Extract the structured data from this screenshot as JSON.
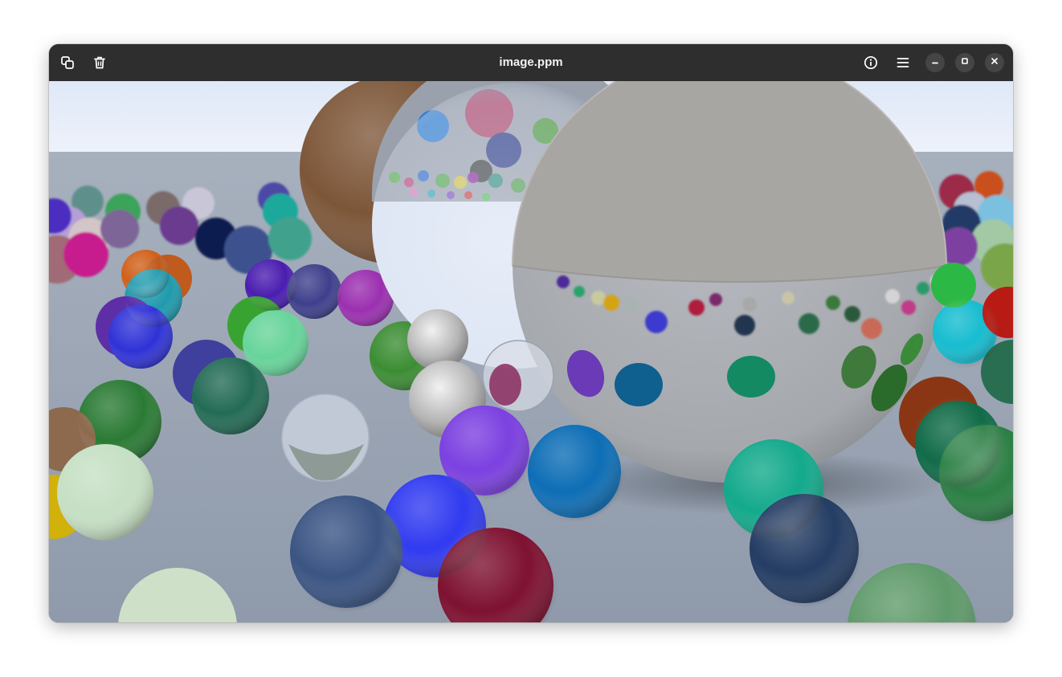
{
  "window": {
    "title": "image.ppm"
  },
  "toolbar": {
    "left": [
      {
        "name": "copy-button",
        "icon": "copy-icon"
      },
      {
        "name": "delete-button",
        "icon": "trash-icon"
      }
    ],
    "right": [
      {
        "name": "properties-button",
        "icon": "info-icon"
      },
      {
        "name": "main-menu-button",
        "icon": "hamburger-menu-icon"
      }
    ]
  },
  "window_controls": [
    "minimize",
    "maximize",
    "close"
  ],
  "colors": {
    "headerbar": "#2e2e2e",
    "control_bg": "#454545",
    "sky": "#e3ebf8",
    "ground": "#9aa4b4"
  }
}
